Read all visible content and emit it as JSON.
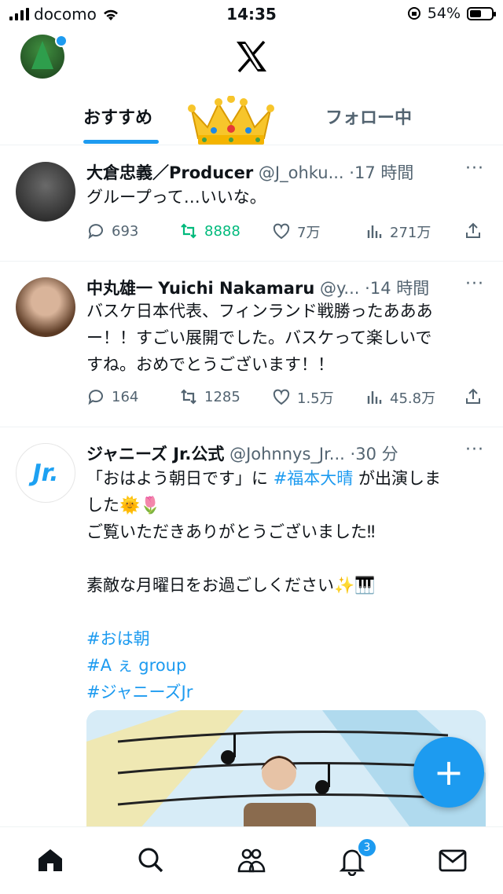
{
  "status_bar": {
    "carrier": "docomo",
    "time": "14:35",
    "battery": "54%",
    "battery_level": 0.54
  },
  "tabs": {
    "active": "おすすめ",
    "inactive": "フォロー中"
  },
  "tweets": [
    {
      "name": "大倉忠義／Producer",
      "handle": "@J_ohku...",
      "sep": "·",
      "time": "17 時間",
      "lines": [
        "グループって…いいな。"
      ],
      "replies": "693",
      "retweets": "8888",
      "likes": "7万",
      "views": "271万"
    },
    {
      "name": "中丸雄一 Yuichi Nakamaru",
      "handle": "@y...",
      "sep": "·",
      "time": "14 時間",
      "lines": [
        "バスケ日本代表、フィンランド戦勝ったあああ",
        "ー！！すごい展開でした。バスケって楽しいで",
        "すね。おめでとうございます！！"
      ],
      "replies": "164",
      "retweets": "1285",
      "likes": "1.5万",
      "views": "45.8万"
    },
    {
      "name": "ジャニーズ Jr.公式",
      "handle": "@Johnnys_Jr...",
      "sep": "·",
      "time": "30 分",
      "line1_pre": "「おはよう朝日です」に ",
      "line1_tag": "#福本大晴",
      "line1_post": " が出演しま",
      "line2": "した🌞🌷",
      "line3": "ご覧いただきありがとうございました‼",
      "line4": "素敵な月曜日をお過ごしください✨🎹",
      "tags": [
        "#おは朝",
        "#A ぇ group",
        "#ジャニーズJr"
      ],
      "avatar_logo": "Jr."
    }
  ],
  "fab_label": "+",
  "nav": {
    "notifications_badge": "3"
  },
  "icons": [
    "home-icon",
    "search-icon",
    "communities-icon",
    "bell-icon",
    "mail-icon",
    "reply-icon",
    "retweet-icon",
    "like-icon",
    "views-icon",
    "share-icon",
    "more-icon",
    "crown-icon",
    "x-logo"
  ],
  "colors": {
    "accent": "#1d9bf0",
    "retweet_active": "#00ba7c",
    "secondary_text": "#536471"
  }
}
